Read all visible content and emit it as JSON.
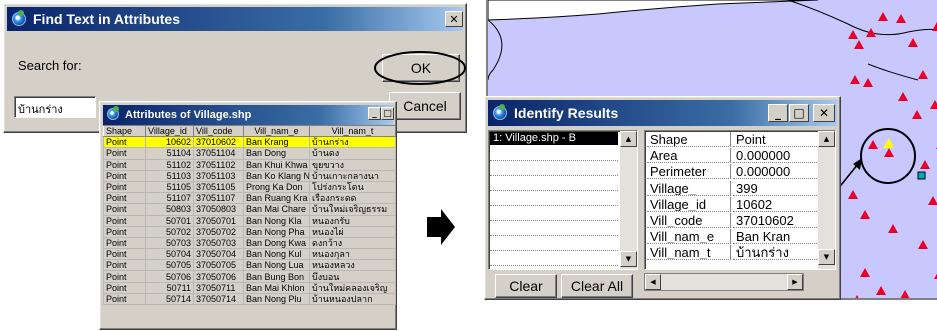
{
  "find_dialog": {
    "title": "Find Text in Attributes",
    "close_glyph": "✕",
    "search_label": "Search for:",
    "search_value": "บ้านกร่าง",
    "ok_label": "OK",
    "cancel_label": "Cancel"
  },
  "attr_table": {
    "title": "Attributes of Village.shp",
    "min_glyph": "_",
    "max_glyph": "□",
    "columns": [
      "Shape",
      "Village_id",
      "Vill_code",
      "Vill_nam_e",
      "Vill_nam_t"
    ],
    "rows": [
      [
        "Point",
        "10602",
        "37010602",
        "Ban Krang",
        "บ้านกร่าง"
      ],
      [
        "Point",
        "51104",
        "37051104",
        "Ban Dong",
        "บ้านดง"
      ],
      [
        "Point",
        "51102",
        "37051102",
        "Ban Khui Khwa",
        "ขุยขวาง"
      ],
      [
        "Point",
        "51103",
        "37051103",
        "Ban Ko Klang N",
        "บ้านเกาะกลางนา"
      ],
      [
        "Point",
        "51105",
        "37051105",
        "Prong Ka Don",
        "โปร่งกระโดน"
      ],
      [
        "Point",
        "51107",
        "37051107",
        "Ban Ruang Kra",
        "เรืองกระดด"
      ],
      [
        "Point",
        "50803",
        "37050803",
        "Ban Mai Chare",
        "บ้านใหม่เจริญธรรม"
      ],
      [
        "Point",
        "50701",
        "37050701",
        "Ban Nong Kla",
        "หนองกรับ"
      ],
      [
        "Point",
        "50702",
        "37050702",
        "Ban Nong Pha",
        "หนองไผ่"
      ],
      [
        "Point",
        "50703",
        "37050703",
        "Ban Dong Kwa",
        "ดงกว้าง"
      ],
      [
        "Point",
        "50704",
        "37050704",
        "Ban Nong Kul",
        "หนองกุลา"
      ],
      [
        "Point",
        "50705",
        "37050705",
        "Ban Nong Lua",
        "หนองหลวง"
      ],
      [
        "Point",
        "50706",
        "37050706",
        "Ban Bung Bon",
        "บึงบอน"
      ],
      [
        "Point",
        "50711",
        "37050711",
        "Ban Mai Khlon",
        "บ้านใหม่คลองเจริญ"
      ],
      [
        "Point",
        "50714",
        "37050714",
        "Ban Nong Plu",
        "บ้านหนองปลาก"
      ]
    ],
    "selected_row": 0
  },
  "arrow_icon": "right-block-arrow",
  "identify": {
    "title": "Identify Results",
    "min_glyph": "_",
    "max_glyph": "□",
    "close_glyph": "✕",
    "list_items": [
      "1: Village.shp - B"
    ],
    "fields": [
      [
        "Shape",
        "Point"
      ],
      [
        "Area",
        "0.000000"
      ],
      [
        "Perimeter",
        "0.000000"
      ],
      [
        "Village_",
        "399"
      ],
      [
        "Village_id",
        "10602"
      ],
      [
        "Vill_code",
        "37010602"
      ],
      [
        "Vill_nam_e",
        "Ban Kran"
      ],
      [
        "Vill_nam_t",
        "บ้านกร่าง"
      ]
    ],
    "clear_label": "Clear",
    "clear_all_label": "Clear All"
  },
  "colors": {
    "map_bg": "#c8c8ff",
    "marker": "#e8002a",
    "highlight": "#ffff00",
    "title_blue": "#0a246a"
  }
}
